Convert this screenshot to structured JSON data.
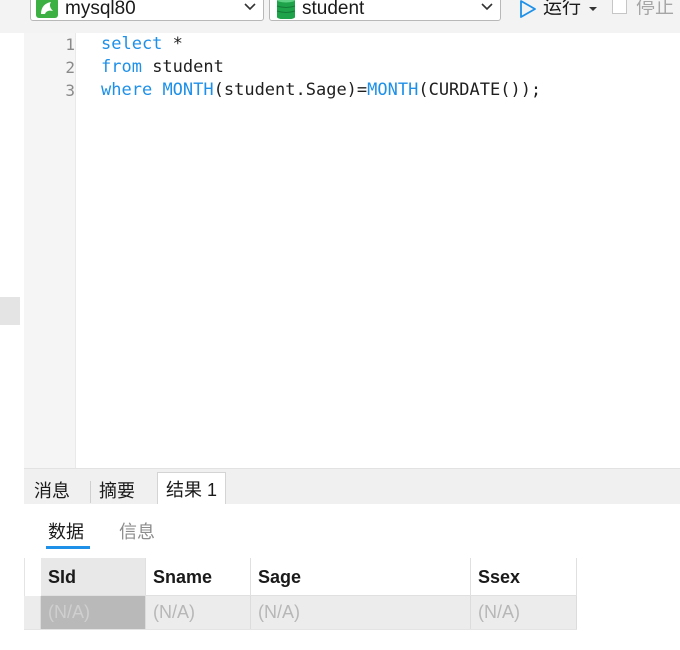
{
  "toolbar": {
    "connection": "mysql80",
    "database": "student",
    "run_label": "运行",
    "stop_label": "停止"
  },
  "editor": {
    "lines": [
      {
        "num": "1",
        "parts": [
          {
            "t": "select",
            "k": "kw"
          },
          {
            "t": " *",
            "k": ""
          }
        ]
      },
      {
        "num": "2",
        "parts": [
          {
            "t": "from",
            "k": "kw"
          },
          {
            "t": " student",
            "k": ""
          }
        ]
      },
      {
        "num": "3",
        "parts": [
          {
            "t": "where",
            "k": "kw"
          },
          {
            "t": " ",
            "k": ""
          },
          {
            "t": "MONTH",
            "k": "fn"
          },
          {
            "t": "(student.Sage)=",
            "k": ""
          },
          {
            "t": "MONTH",
            "k": "fn"
          },
          {
            "t": "(CURDATE());",
            "k": ""
          }
        ]
      }
    ]
  },
  "result_tabs": [
    "消息",
    "摘要",
    "结果 1"
  ],
  "active_result_tab": "结果 1",
  "sub_tabs": [
    "数据",
    "信息"
  ],
  "active_sub_tab": "数据",
  "grid": {
    "columns": [
      "SId",
      "Sname",
      "Sage",
      "Ssex"
    ],
    "rows": [
      [
        "(N/A)",
        "(N/A)",
        "(N/A)",
        "(N/A)"
      ]
    ]
  },
  "colors": {
    "keyword": "#1e90e8",
    "database_icon": "#1fa34a",
    "play_icon": "#1e90e8",
    "connection_icon": "#3cb043"
  }
}
